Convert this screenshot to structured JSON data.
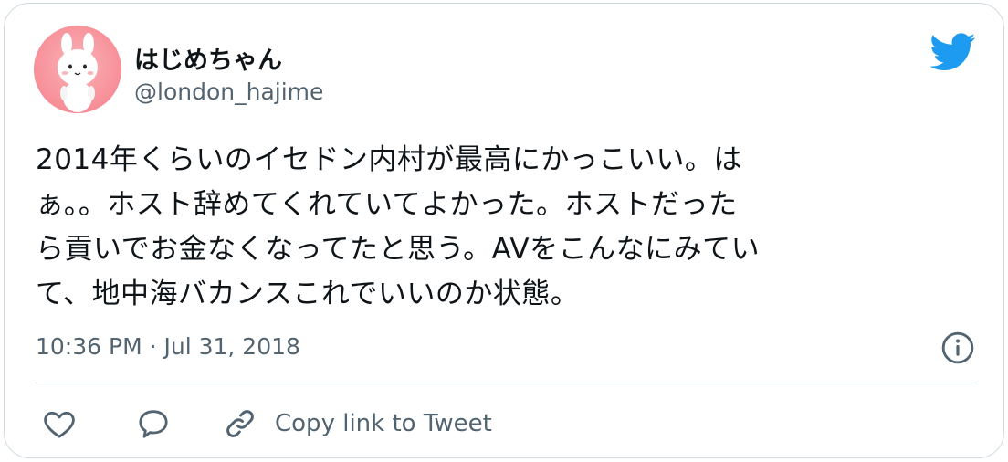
{
  "author": {
    "display_name": "はじめちゃん",
    "handle": "@london_hajime",
    "avatar_icon": "cony-bunny-avatar"
  },
  "tweet": {
    "lines": [
      "2014年くらいのイセドン内村が最高にかっこいい。は",
      "ぁ。。ホスト辞めてくれていてよかった。ホストだった",
      "ら貢いでお金なくなってたと思う。AVをこんなにみてい",
      "て、地中海バカンスこれでいいのか状態。"
    ],
    "timestamp": "10:36 PM · Jul 31, 2018"
  },
  "actions": {
    "like_icon": "heart-icon",
    "reply_icon": "speech-bubble-icon",
    "copy_link_icon": "link-icon",
    "copy_link_label": "Copy link to Tweet"
  },
  "colors": {
    "brand": "#1d9bf0",
    "text": "#0f1419",
    "muted": "#536471",
    "border": "#cfd9de"
  }
}
